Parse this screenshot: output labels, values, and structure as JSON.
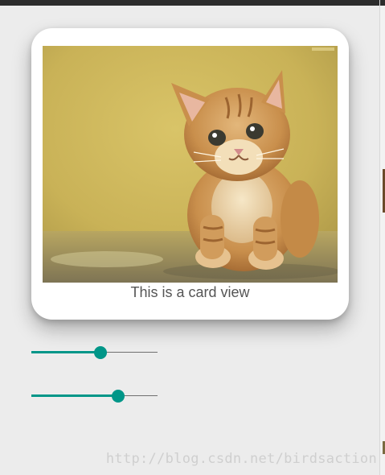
{
  "card": {
    "caption": "This is a card view",
    "image_subject": "kitten-photo"
  },
  "sliders": [
    {
      "name": "slider-1",
      "value_fraction": 0.55
    },
    {
      "name": "slider-2",
      "value_fraction": 0.69
    }
  ],
  "colors": {
    "accent": "#009688",
    "background": "#ececec",
    "card": "#ffffff",
    "caption_text": "#555555"
  },
  "watermark": {
    "text": "http://blog.csdn.net/birdsaction"
  }
}
